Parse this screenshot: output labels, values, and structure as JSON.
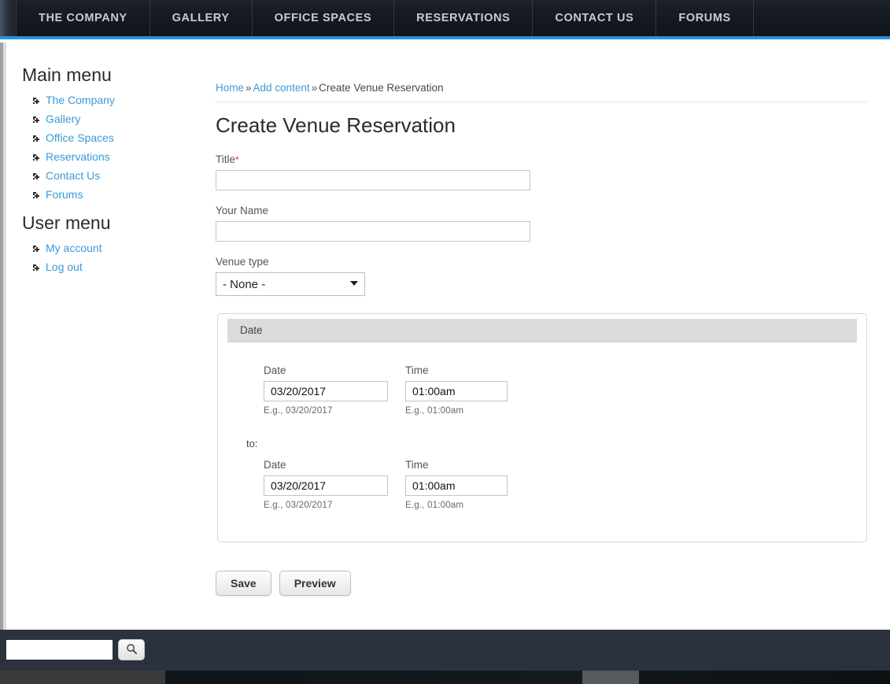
{
  "topnav": {
    "items": [
      {
        "label": "THE COMPANY"
      },
      {
        "label": "GALLERY"
      },
      {
        "label": "OFFICE SPACES"
      },
      {
        "label": "RESERVATIONS"
      },
      {
        "label": "CONTACT US"
      },
      {
        "label": "FORUMS"
      }
    ],
    "accent_color": "#2b8fe0",
    "background_color": "#141a20"
  },
  "sidebar": {
    "main_menu_title": "Main menu",
    "main_menu_items": [
      {
        "label": "The Company"
      },
      {
        "label": "Gallery"
      },
      {
        "label": "Office Spaces"
      },
      {
        "label": "Reservations"
      },
      {
        "label": "Contact Us"
      },
      {
        "label": "Forums"
      }
    ],
    "user_menu_title": "User menu",
    "user_menu_items": [
      {
        "label": "My account"
      },
      {
        "label": "Log out"
      }
    ],
    "link_color": "#3b9ad6"
  },
  "breadcrumb": {
    "home": "Home",
    "sep1": "»",
    "add_content": "Add content",
    "sep2": "»",
    "current": "Create Venue Reservation"
  },
  "main": {
    "page_title": "Create Venue Reservation",
    "title_field": {
      "label": "Title",
      "required_marker": "*",
      "value": "",
      "placeholder": ""
    },
    "your_name_field": {
      "label": "Your Name",
      "value": "",
      "placeholder": ""
    },
    "venue_type_field": {
      "label": "Venue type",
      "selected": "- None -",
      "options": [
        "- None -"
      ]
    },
    "date_fieldset": {
      "legend": "Date",
      "from": {
        "date_label": "Date",
        "date_value": "03/20/2017",
        "date_hint": "E.g., 03/20/2017",
        "time_label": "Time",
        "time_value": "01:00am",
        "time_hint": "E.g., 01:00am"
      },
      "to_label": "to:",
      "to": {
        "date_label": "Date",
        "date_value": "03/20/2017",
        "date_hint": "E.g., 03/20/2017",
        "time_label": "Time",
        "time_value": "01:00am",
        "time_hint": "E.g., 01:00am"
      }
    },
    "save_label": "Save",
    "preview_label": "Preview"
  },
  "footer": {
    "search_value": "",
    "search_placeholder": "",
    "search_icon": "search-icon",
    "background_color": "#2b323d"
  }
}
